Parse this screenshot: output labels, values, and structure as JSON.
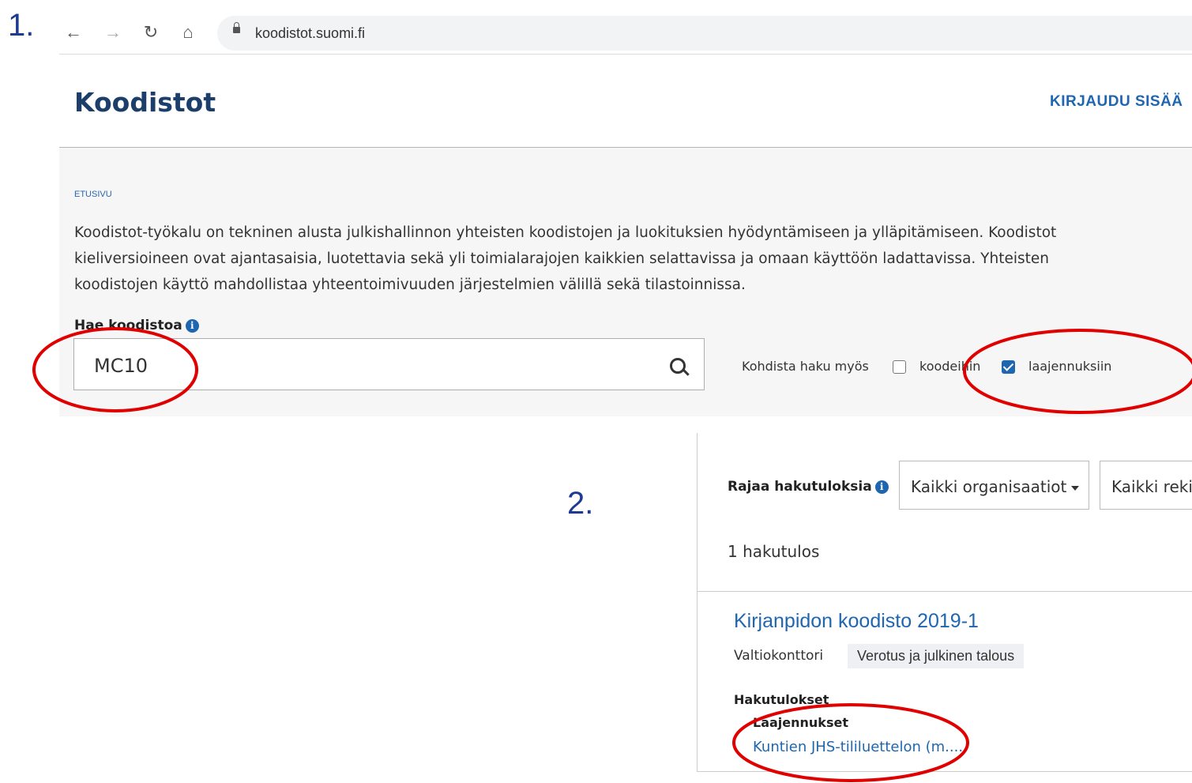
{
  "steps": {
    "first": "1.",
    "second": "2."
  },
  "browser": {
    "url": "koodistot.suomi.fi"
  },
  "header": {
    "title": "Koodistot",
    "login_label": "KIRJAUDU SISÄÄ"
  },
  "breadcrumb": "ETUSIVU",
  "intro": {
    "line1": "Koodistot-työkalu on tekninen alusta julkishallinnon yhteisten koodistojen ja luokituksien hyödyntämiseen ja ylläpitämiseen. Koodistot",
    "line2": "kieliversioineen ovat ajantasaisia, luotettavia sekä yli toimialarajojen kaikkien selattavissa ja omaan käyttöön ladattavissa. Yhteisten",
    "line3": "koodistojen käyttö mahdollistaa yhteentoimivuuden järjestelmien välillä sekä tilastoinnissa."
  },
  "search": {
    "label": "Hae koodistoa",
    "value": "MC10",
    "filter_label": "Kohdista haku myös",
    "option_codes": "koodeihin",
    "option_codes_checked": false,
    "option_extensions": "laajennuksiin",
    "option_extensions_checked": true
  },
  "results": {
    "filter_label": "Rajaa hakutuloksia",
    "org_dropdown": "Kaikki organisaatiot",
    "registry_dropdown": "Kaikki rekis",
    "count": "1 hakutulos",
    "item": {
      "title": "Kirjanpidon koodisto 2019-1",
      "organization": "Valtiokonttori",
      "tag": "Verotus ja julkinen talous",
      "hits_heading": "Hakutulokset",
      "hits_subheading": "Laajennukset",
      "hit_link": "Kuntien JHS-tililuettelon (m...."
    }
  },
  "icons": {
    "info": "i"
  },
  "colors": {
    "annotation": "#e00000",
    "accent": "#1f66b1",
    "title": "#1b3f6a"
  }
}
